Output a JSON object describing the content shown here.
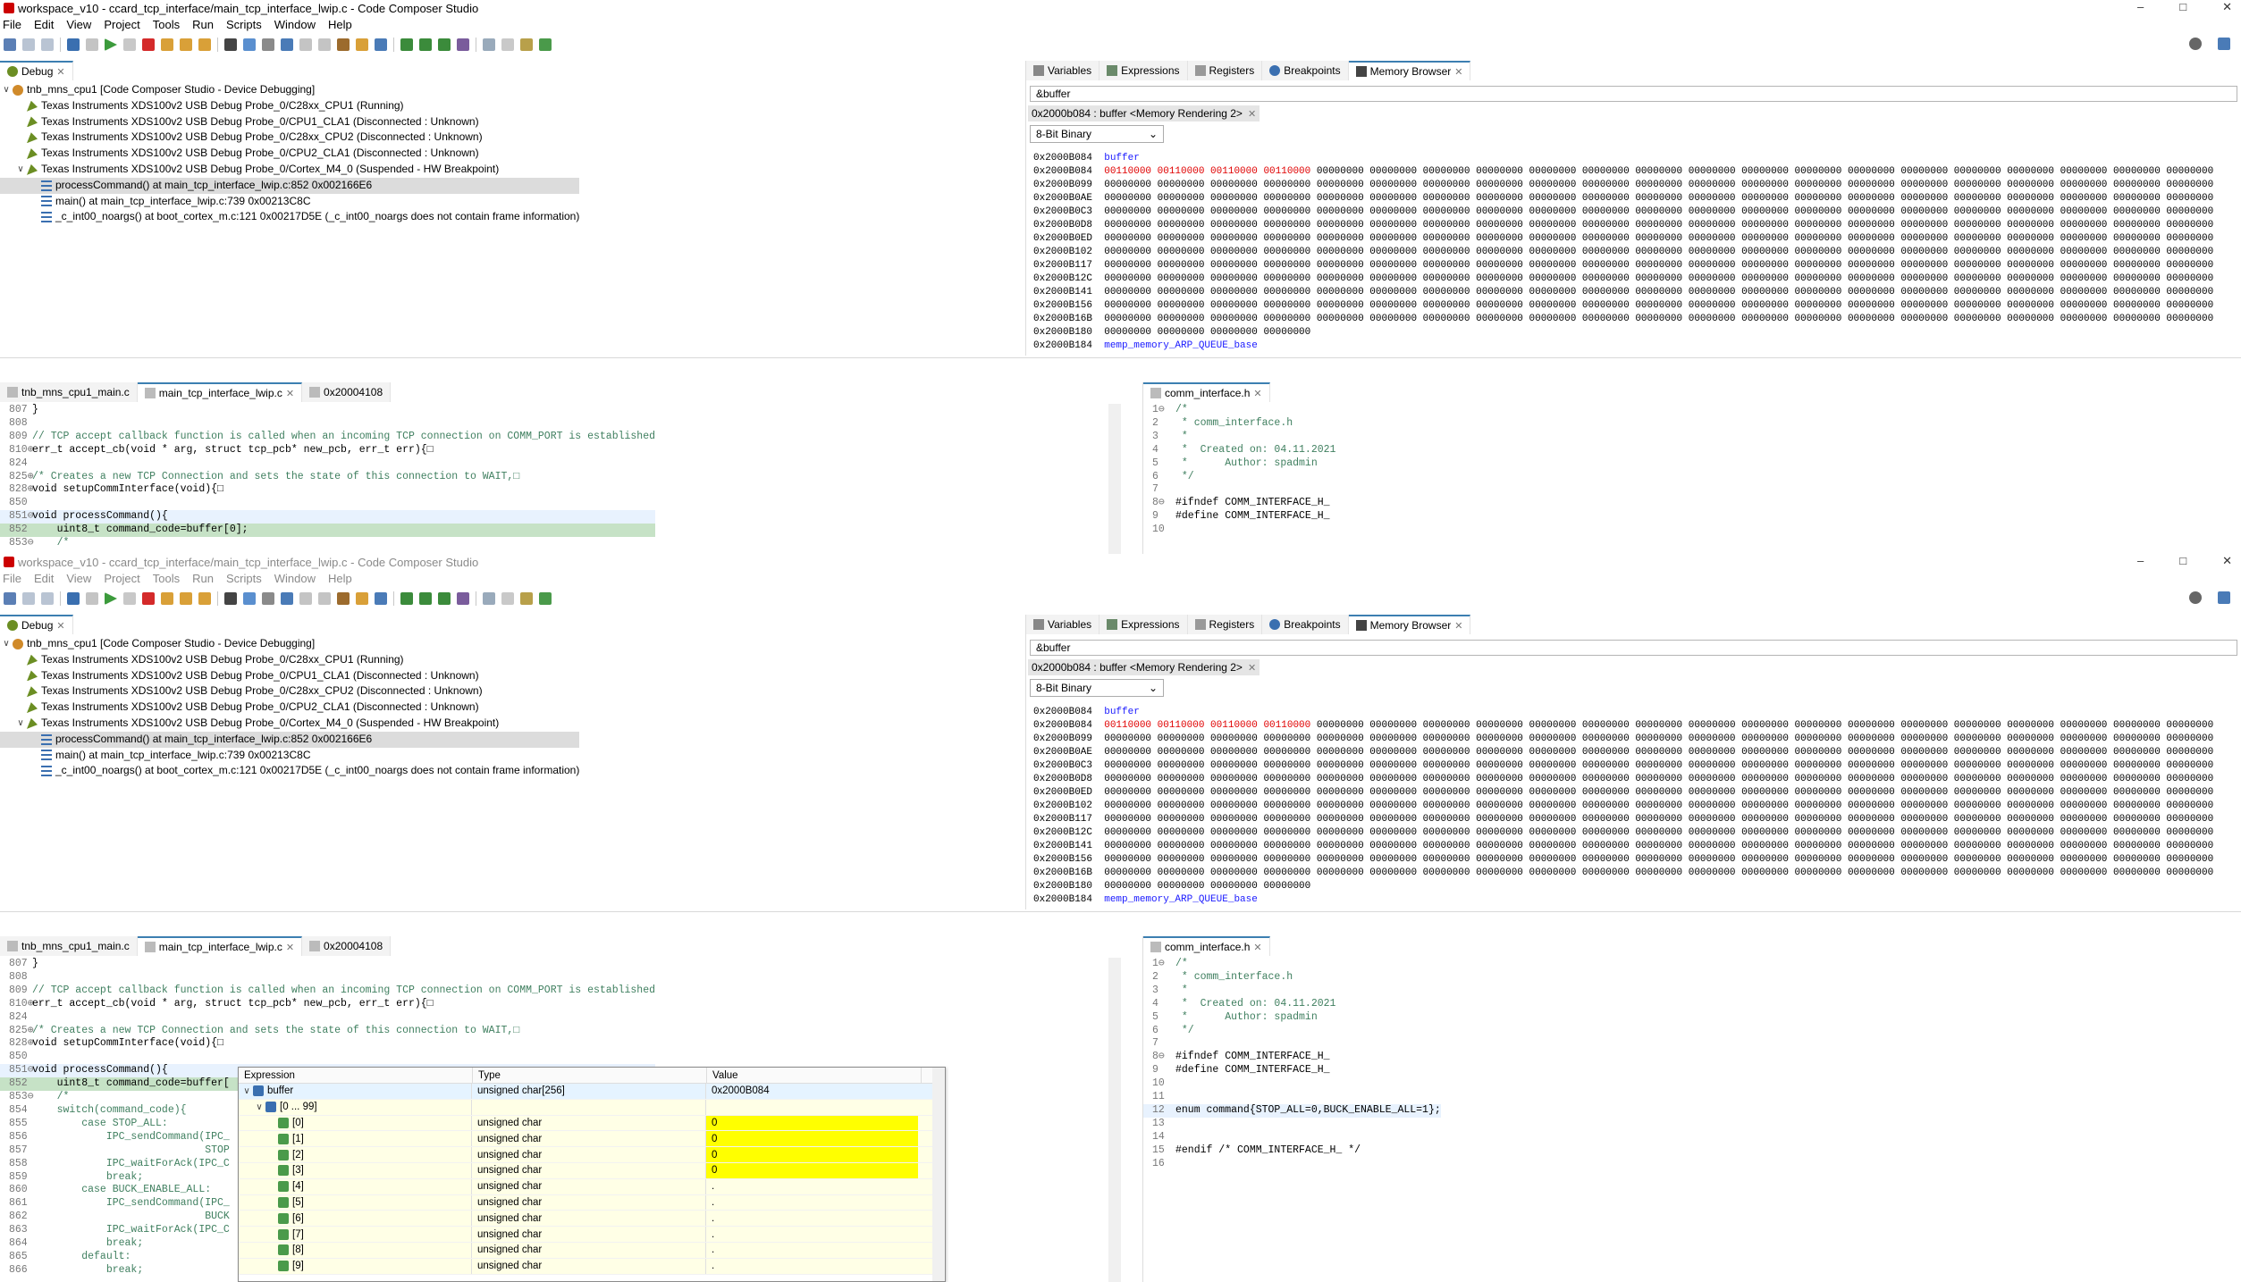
{
  "window": {
    "title": "workspace_v10 - ccard_tcp_interface/main_tcp_interface_lwip.c - Code Composer Studio",
    "controls": [
      "–",
      "□",
      "✕"
    ]
  },
  "menu": [
    "File",
    "Edit",
    "View",
    "Project",
    "Tools",
    "Run",
    "Scripts",
    "Window",
    "Help"
  ],
  "debug_view": {
    "tab_label": "Debug",
    "items": [
      {
        "text": "tnb_mns_cpu1 [Code Composer Studio - Device Debugging]",
        "level": 0,
        "icon": "debug-session-icon",
        "twisty": "∨"
      },
      {
        "text": "Texas Instruments XDS100v2 USB Debug Probe_0/C28xx_CPU1 (Running)",
        "level": 1,
        "icon": "probe-icon",
        "twisty": ""
      },
      {
        "text": "Texas Instruments XDS100v2 USB Debug Probe_0/CPU1_CLA1 (Disconnected : Unknown)",
        "level": 1,
        "icon": "probe-icon",
        "twisty": ""
      },
      {
        "text": "Texas Instruments XDS100v2 USB Debug Probe_0/C28xx_CPU2 (Disconnected : Unknown)",
        "level": 1,
        "icon": "probe-icon",
        "twisty": ""
      },
      {
        "text": "Texas Instruments XDS100v2 USB Debug Probe_0/CPU2_CLA1 (Disconnected : Unknown)",
        "level": 1,
        "icon": "probe-icon",
        "twisty": ""
      },
      {
        "text": "Texas Instruments XDS100v2 USB Debug Probe_0/Cortex_M4_0 (Suspended - HW Breakpoint)",
        "level": 1,
        "icon": "probe-icon",
        "twisty": "∨"
      },
      {
        "text": "processCommand() at main_tcp_interface_lwip.c:852 0x002166E6",
        "level": 2,
        "icon": "stack-frame-icon",
        "twisty": "",
        "selected": true
      },
      {
        "text": "main() at main_tcp_interface_lwip.c:739 0x00213C8C",
        "level": 2,
        "icon": "stack-frame-icon",
        "twisty": ""
      },
      {
        "text": "_c_int00_noargs() at boot_cortex_m.c:121 0x00217D5E  (_c_int00_noargs does not contain frame information)",
        "level": 2,
        "icon": "stack-frame-icon",
        "twisty": ""
      }
    ]
  },
  "right_view_tabs": [
    "Variables",
    "Expressions",
    "Registers",
    "Breakpoints",
    "Memory Browser"
  ],
  "memory": {
    "address_input": "&buffer",
    "rendering_tab": "0x2000b084 : buffer <Memory Rendering 2>",
    "format": "8-Bit Binary",
    "lines": [
      {
        "addr": "0x2000B084",
        "label": "buffer"
      },
      {
        "addr": "0x2000B084",
        "changed": "00110000 00110000 00110000 00110000",
        "rest": " 00000000 00000000 00000000 00000000 00000000 00000000 00000000 00000000 00000000 00000000 00000000 00000000 00000000 00000000 00000000 00000000 00000000"
      },
      {
        "addr": "0x2000B099",
        "rest": "00000000 00000000 00000000 00000000 00000000 00000000 00000000 00000000 00000000 00000000 00000000 00000000 00000000 00000000 00000000 00000000 00000000 00000000 00000000 00000000 00000000"
      },
      {
        "addr": "0x2000B0AE",
        "rest": "00000000 00000000 00000000 00000000 00000000 00000000 00000000 00000000 00000000 00000000 00000000 00000000 00000000 00000000 00000000 00000000 00000000 00000000 00000000 00000000 00000000"
      },
      {
        "addr": "0x2000B0C3",
        "rest": "00000000 00000000 00000000 00000000 00000000 00000000 00000000 00000000 00000000 00000000 00000000 00000000 00000000 00000000 00000000 00000000 00000000 00000000 00000000 00000000 00000000"
      },
      {
        "addr": "0x2000B0D8",
        "rest": "00000000 00000000 00000000 00000000 00000000 00000000 00000000 00000000 00000000 00000000 00000000 00000000 00000000 00000000 00000000 00000000 00000000 00000000 00000000 00000000 00000000"
      },
      {
        "addr": "0x2000B0ED",
        "rest": "00000000 00000000 00000000 00000000 00000000 00000000 00000000 00000000 00000000 00000000 00000000 00000000 00000000 00000000 00000000 00000000 00000000 00000000 00000000 00000000 00000000"
      },
      {
        "addr": "0x2000B102",
        "rest": "00000000 00000000 00000000 00000000 00000000 00000000 00000000 00000000 00000000 00000000 00000000 00000000 00000000 00000000 00000000 00000000 00000000 00000000 00000000 00000000 00000000"
      },
      {
        "addr": "0x2000B117",
        "rest": "00000000 00000000 00000000 00000000 00000000 00000000 00000000 00000000 00000000 00000000 00000000 00000000 00000000 00000000 00000000 00000000 00000000 00000000 00000000 00000000 00000000"
      },
      {
        "addr": "0x2000B12C",
        "rest": "00000000 00000000 00000000 00000000 00000000 00000000 00000000 00000000 00000000 00000000 00000000 00000000 00000000 00000000 00000000 00000000 00000000 00000000 00000000 00000000 00000000"
      },
      {
        "addr": "0x2000B141",
        "rest": "00000000 00000000 00000000 00000000 00000000 00000000 00000000 00000000 00000000 00000000 00000000 00000000 00000000 00000000 00000000 00000000 00000000 00000000 00000000 00000000 00000000"
      },
      {
        "addr": "0x2000B156",
        "rest": "00000000 00000000 00000000 00000000 00000000 00000000 00000000 00000000 00000000 00000000 00000000 00000000 00000000 00000000 00000000 00000000 00000000 00000000 00000000 00000000 00000000"
      },
      {
        "addr": "0x2000B16B",
        "rest": "00000000 00000000 00000000 00000000 00000000 00000000 00000000 00000000 00000000 00000000 00000000 00000000 00000000 00000000 00000000 00000000 00000000 00000000 00000000 00000000 00000000"
      },
      {
        "addr": "0x2000B180",
        "rest": "00000000 00000000 00000000 00000000"
      },
      {
        "addr": "0x2000B184",
        "label": "memp_memory_ARP_QUEUE_base"
      }
    ]
  },
  "editor_tabs": [
    {
      "label": "tnb_mns_cpu1_main.c",
      "active": false,
      "close": false
    },
    {
      "label": "main_tcp_interface_lwip.c",
      "active": true,
      "close": true
    },
    {
      "label": "0x20004108",
      "active": false,
      "close": false
    }
  ],
  "code_short": [
    {
      "ln": "807",
      "text": "}",
      "cls": ""
    },
    {
      "ln": "808",
      "text": "",
      "cls": ""
    },
    {
      "ln": "809",
      "text": "// TCP accept callback function is called when an incoming TCP connection on COMM_PORT is established",
      "cls": "cm"
    },
    {
      "ln": "810⊕",
      "text": "err_t accept_cb(void * arg, struct tcp_pcb* new_pcb, err_t err){□",
      "cls": ""
    },
    {
      "ln": "824",
      "text": "",
      "cls": ""
    },
    {
      "ln": "825⊕",
      "text": "/* Creates a new TCP Connection and sets the state of this connection to WAIT,□",
      "cls": "cm"
    },
    {
      "ln": "828⊕",
      "text": "void setupCommInterface(void){□",
      "cls": ""
    },
    {
      "ln": "850",
      "text": "",
      "cls": ""
    },
    {
      "ln": "851⊖",
      "text": "void processCommand(){",
      "cls": "hl"
    },
    {
      "ln": "852",
      "text": "    uint8_t command_code=buffer[0];",
      "cls": "cur"
    },
    {
      "ln": "853⊖",
      "text": "    /*",
      "cls": "cm"
    }
  ],
  "code_long": [
    {
      "ln": "807",
      "text": "}",
      "cls": ""
    },
    {
      "ln": "808",
      "text": "",
      "cls": ""
    },
    {
      "ln": "809",
      "text": "// TCP accept callback function is called when an incoming TCP connection on COMM_PORT is established",
      "cls": "cm"
    },
    {
      "ln": "810⊕",
      "text": "err_t accept_cb(void * arg, struct tcp_pcb* new_pcb, err_t err){□",
      "cls": ""
    },
    {
      "ln": "824",
      "text": "",
      "cls": ""
    },
    {
      "ln": "825⊕",
      "text": "/* Creates a new TCP Connection and sets the state of this connection to WAIT,□",
      "cls": "cm"
    },
    {
      "ln": "828⊕",
      "text": "void setupCommInterface(void){□",
      "cls": ""
    },
    {
      "ln": "850",
      "text": "",
      "cls": ""
    },
    {
      "ln": "851⊖",
      "text": "void processCommand(){",
      "cls": "hl"
    },
    {
      "ln": "852",
      "text": "    uint8_t command_code=buffer[",
      "cls": "cur"
    },
    {
      "ln": "853⊖",
      "text": "    /*",
      "cls": "cm"
    },
    {
      "ln": "854",
      "text": "    switch(command_code){",
      "cls": "cm"
    },
    {
      "ln": "855",
      "text": "        case STOP_ALL:",
      "cls": "cm"
    },
    {
      "ln": "856",
      "text": "            IPC_sendCommand(IPC_",
      "cls": "cm"
    },
    {
      "ln": "857",
      "text": "                            STOP",
      "cls": "cm"
    },
    {
      "ln": "858",
      "text": "            IPC_waitForAck(IPC_C",
      "cls": "cm"
    },
    {
      "ln": "859",
      "text": "            break;",
      "cls": "cm"
    },
    {
      "ln": "860",
      "text": "        case BUCK_ENABLE_ALL:",
      "cls": "cm"
    },
    {
      "ln": "861",
      "text": "            IPC_sendCommand(IPC_",
      "cls": "cm"
    },
    {
      "ln": "862",
      "text": "                            BUCK",
      "cls": "cm"
    },
    {
      "ln": "863",
      "text": "            IPC_waitForAck(IPC_C",
      "cls": "cm"
    },
    {
      "ln": "864",
      "text": "            break;",
      "cls": "cm"
    },
    {
      "ln": "865",
      "text": "        default:",
      "cls": "cm"
    },
    {
      "ln": "866",
      "text": "            break;",
      "cls": "cm"
    }
  ],
  "header_tab": "comm_interface.h",
  "header_short": [
    {
      "ln": "1⊖",
      "text": "/*",
      "cls": "cm"
    },
    {
      "ln": "2",
      "text": " * comm_interface.h",
      "cls": "cm"
    },
    {
      "ln": "3",
      "text": " *",
      "cls": "cm"
    },
    {
      "ln": "4",
      "text": " *  Created on: 04.11.2021",
      "cls": "cm"
    },
    {
      "ln": "5",
      "text": " *      Author: spadmin",
      "cls": "cm"
    },
    {
      "ln": "6",
      "text": " */",
      "cls": "cm"
    },
    {
      "ln": "7",
      "text": "",
      "cls": ""
    },
    {
      "ln": "8⊖",
      "text": "#ifndef COMM_INTERFACE_H_",
      "cls": ""
    },
    {
      "ln": "9",
      "text": "#define COMM_INTERFACE_H_",
      "cls": ""
    },
    {
      "ln": "10",
      "text": "",
      "cls": ""
    }
  ],
  "header_long": [
    {
      "ln": "1⊖",
      "text": "/*",
      "cls": "cm"
    },
    {
      "ln": "2",
      "text": " * comm_interface.h",
      "cls": "cm"
    },
    {
      "ln": "3",
      "text": " *",
      "cls": "cm"
    },
    {
      "ln": "4",
      "text": " *  Created on: 04.11.2021",
      "cls": "cm"
    },
    {
      "ln": "5",
      "text": " *      Author: spadmin",
      "cls": "cm"
    },
    {
      "ln": "6",
      "text": " */",
      "cls": "cm"
    },
    {
      "ln": "7",
      "text": "",
      "cls": ""
    },
    {
      "ln": "8⊖",
      "text": "#ifndef COMM_INTERFACE_H_",
      "cls": ""
    },
    {
      "ln": "9",
      "text": "#define COMM_INTERFACE_H_",
      "cls": ""
    },
    {
      "ln": "10",
      "text": "",
      "cls": ""
    },
    {
      "ln": "11",
      "text": "",
      "cls": ""
    },
    {
      "ln": "12",
      "text": "enum command{STOP_ALL=0,BUCK_ENABLE_ALL=1};",
      "cls": "hl"
    },
    {
      "ln": "13",
      "text": "",
      "cls": ""
    },
    {
      "ln": "14",
      "text": "",
      "cls": ""
    },
    {
      "ln": "15",
      "text": "#endif /* COMM_INTERFACE_H_ */",
      "cls": ""
    },
    {
      "ln": "16",
      "text": "",
      "cls": ""
    }
  ],
  "hover": {
    "headers": [
      "Expression",
      "Type",
      "Value"
    ],
    "rows": [
      {
        "expr": "buffer",
        "type": "unsigned char[256]",
        "value": "0x2000B084",
        "indent": 0,
        "twisty": "∨",
        "icon": "array-icon",
        "sel": true,
        "yellow": false
      },
      {
        "expr": "[0 ... 99]",
        "type": "",
        "value": "",
        "indent": 1,
        "twisty": "∨",
        "icon": "array-icon",
        "sel": false,
        "yellow": false
      },
      {
        "expr": "[0]",
        "type": "unsigned char",
        "value": "0",
        "indent": 2,
        "twisty": "",
        "icon": "variable-icon",
        "sel": false,
        "yellow": true
      },
      {
        "expr": "[1]",
        "type": "unsigned char",
        "value": "0",
        "indent": 2,
        "twisty": "",
        "icon": "variable-icon",
        "sel": false,
        "yellow": true
      },
      {
        "expr": "[2]",
        "type": "unsigned char",
        "value": "0",
        "indent": 2,
        "twisty": "",
        "icon": "variable-icon",
        "sel": false,
        "yellow": true
      },
      {
        "expr": "[3]",
        "type": "unsigned char",
        "value": "0",
        "indent": 2,
        "twisty": "",
        "icon": "variable-icon",
        "sel": false,
        "yellow": true
      },
      {
        "expr": "[4]",
        "type": "unsigned char",
        "value": ".",
        "indent": 2,
        "twisty": "",
        "icon": "variable-icon",
        "sel": false,
        "yellow": false
      },
      {
        "expr": "[5]",
        "type": "unsigned char",
        "value": ".",
        "indent": 2,
        "twisty": "",
        "icon": "variable-icon",
        "sel": false,
        "yellow": false
      },
      {
        "expr": "[6]",
        "type": "unsigned char",
        "value": ".",
        "indent": 2,
        "twisty": "",
        "icon": "variable-icon",
        "sel": false,
        "yellow": false
      },
      {
        "expr": "[7]",
        "type": "unsigned char",
        "value": ".",
        "indent": 2,
        "twisty": "",
        "icon": "variable-icon",
        "sel": false,
        "yellow": false
      },
      {
        "expr": "[8]",
        "type": "unsigned char",
        "value": ".",
        "indent": 2,
        "twisty": "",
        "icon": "variable-icon",
        "sel": false,
        "yellow": false
      },
      {
        "expr": "[9]",
        "type": "unsigned char",
        "value": ".",
        "indent": 2,
        "twisty": "",
        "icon": "variable-icon",
        "sel": false,
        "yellow": false
      }
    ]
  },
  "colors": {
    "selection": "#dcdcdc",
    "changed_memory": "#e00000",
    "label": "#1a1aff",
    "hover_changed": "#ffff00",
    "current_line": "#c6e2c6",
    "comment": "#3f7f5f"
  }
}
